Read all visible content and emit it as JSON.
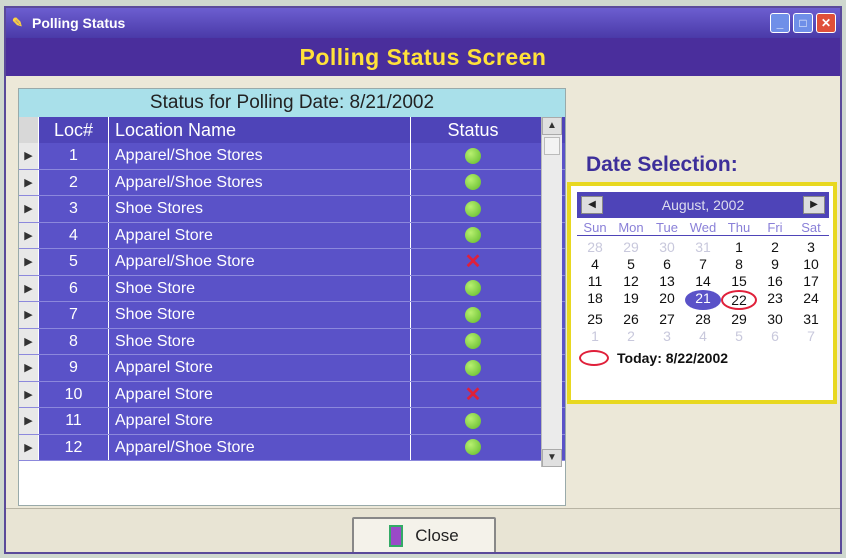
{
  "window": {
    "title": "Polling Status",
    "header": "Polling Status Screen"
  },
  "grid": {
    "caption": "Status for Polling Date: 8/21/2002",
    "columns": [
      "Loc#",
      "Location Name",
      "Status"
    ],
    "rows": [
      {
        "loc": "1",
        "name": "Apparel/Shoe Stores",
        "status": "ok"
      },
      {
        "loc": "2",
        "name": "Apparel/Shoe Stores",
        "status": "ok"
      },
      {
        "loc": "3",
        "name": "Shoe Stores",
        "status": "ok"
      },
      {
        "loc": "4",
        "name": "Apparel Store",
        "status": "ok"
      },
      {
        "loc": "5",
        "name": "Apparel/Shoe Store",
        "status": "failed"
      },
      {
        "loc": "6",
        "name": "Shoe Store",
        "status": "ok"
      },
      {
        "loc": "7",
        "name": "Shoe Store",
        "status": "ok"
      },
      {
        "loc": "8",
        "name": "Shoe Store",
        "status": "ok"
      },
      {
        "loc": "9",
        "name": "Apparel Store",
        "status": "ok"
      },
      {
        "loc": "10",
        "name": "Apparel Store",
        "status": "failed"
      },
      {
        "loc": "11",
        "name": "Apparel Store",
        "status": "ok"
      },
      {
        "loc": "12",
        "name": "Apparel/Shoe Store",
        "status": "ok"
      }
    ]
  },
  "date_selection": {
    "title": "Date Selection:",
    "month_label": "August, 2002",
    "weekdays": [
      "Sun",
      "Mon",
      "Tue",
      "Wed",
      "Thu",
      "Fri",
      "Sat"
    ],
    "days": [
      {
        "d": "28",
        "o": true
      },
      {
        "d": "29",
        "o": true
      },
      {
        "d": "30",
        "o": true
      },
      {
        "d": "31",
        "o": true
      },
      {
        "d": "1"
      },
      {
        "d": "2"
      },
      {
        "d": "3"
      },
      {
        "d": "4"
      },
      {
        "d": "5"
      },
      {
        "d": "6"
      },
      {
        "d": "7"
      },
      {
        "d": "8"
      },
      {
        "d": "9"
      },
      {
        "d": "10"
      },
      {
        "d": "11"
      },
      {
        "d": "12"
      },
      {
        "d": "13"
      },
      {
        "d": "14"
      },
      {
        "d": "15"
      },
      {
        "d": "16"
      },
      {
        "d": "17"
      },
      {
        "d": "18"
      },
      {
        "d": "19"
      },
      {
        "d": "20"
      },
      {
        "d": "21",
        "sel": true
      },
      {
        "d": "22",
        "today": true
      },
      {
        "d": "23"
      },
      {
        "d": "24"
      },
      {
        "d": "25"
      },
      {
        "d": "26"
      },
      {
        "d": "27"
      },
      {
        "d": "28"
      },
      {
        "d": "29"
      },
      {
        "d": "30"
      },
      {
        "d": "31"
      },
      {
        "d": "1",
        "o": true
      },
      {
        "d": "2",
        "o": true
      },
      {
        "d": "3",
        "o": true
      },
      {
        "d": "4",
        "o": true
      },
      {
        "d": "5",
        "o": true
      },
      {
        "d": "6",
        "o": true
      },
      {
        "d": "7",
        "o": true
      }
    ],
    "today_label": "Today: 8/22/2002"
  },
  "footer": {
    "close_label": "Close"
  },
  "colors": {
    "header_bg": "#4a2e9c",
    "header_text": "#ffe23a",
    "status_ok": "#5fb92a",
    "status_failed": "#e0203a"
  }
}
